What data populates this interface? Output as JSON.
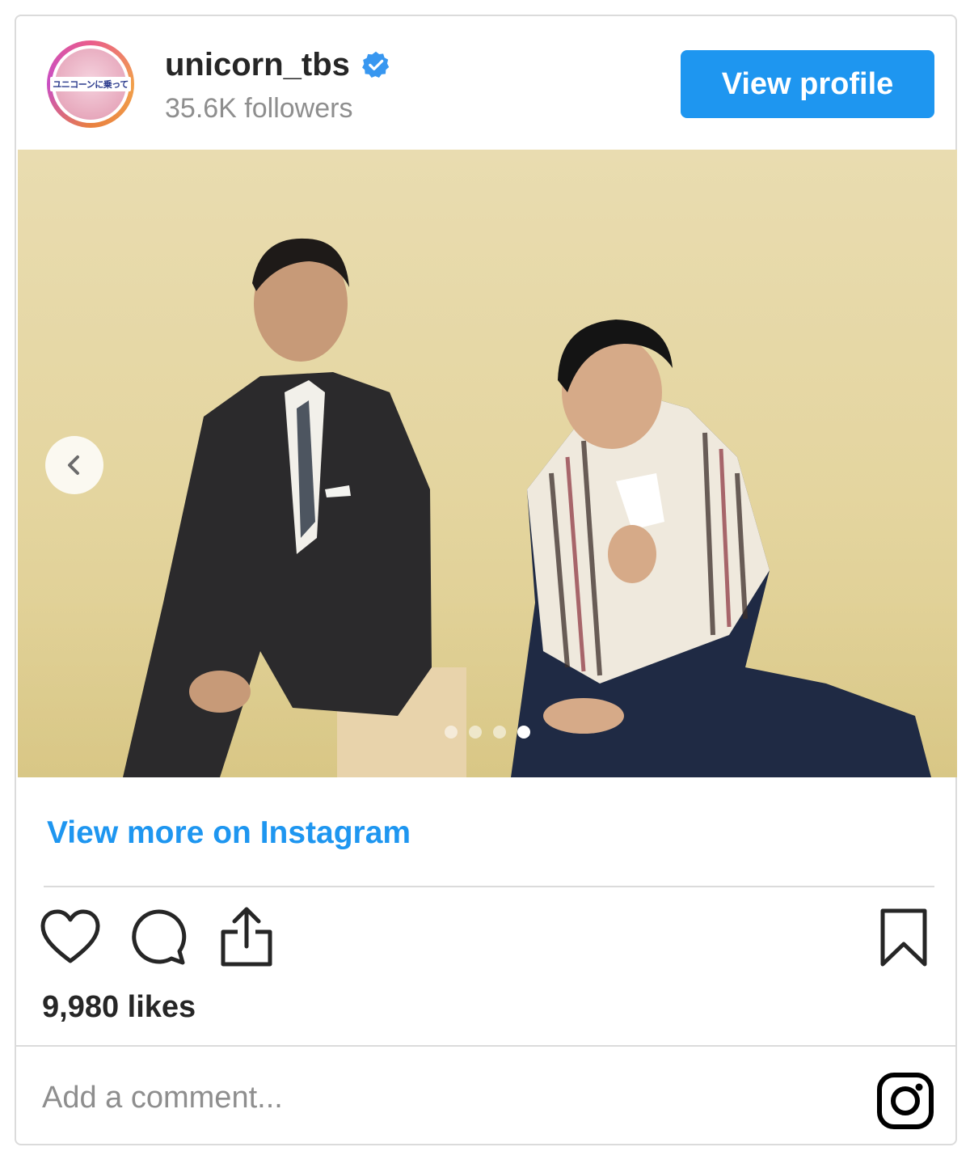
{
  "header": {
    "avatar_text": "ユニコーンに乗って",
    "username": "unicorn_tbs",
    "followers": "35.6K followers",
    "view_profile_label": "View profile"
  },
  "post": {
    "photo_alt": "Two men posing against a yellow backdrop",
    "carousel_count": 4,
    "carousel_active_index": 3
  },
  "link": {
    "view_more_label": "View more on Instagram"
  },
  "actions": {
    "icons": [
      "heart-icon",
      "comment-icon",
      "share-icon",
      "bookmark-icon"
    ]
  },
  "likes_text": "9,980 likes",
  "comment": {
    "placeholder": "Add a comment..."
  },
  "colors": {
    "accent": "#1e96f0",
    "text": "#262626",
    "muted": "#8e8e8e",
    "border": "#dbdbdb"
  }
}
